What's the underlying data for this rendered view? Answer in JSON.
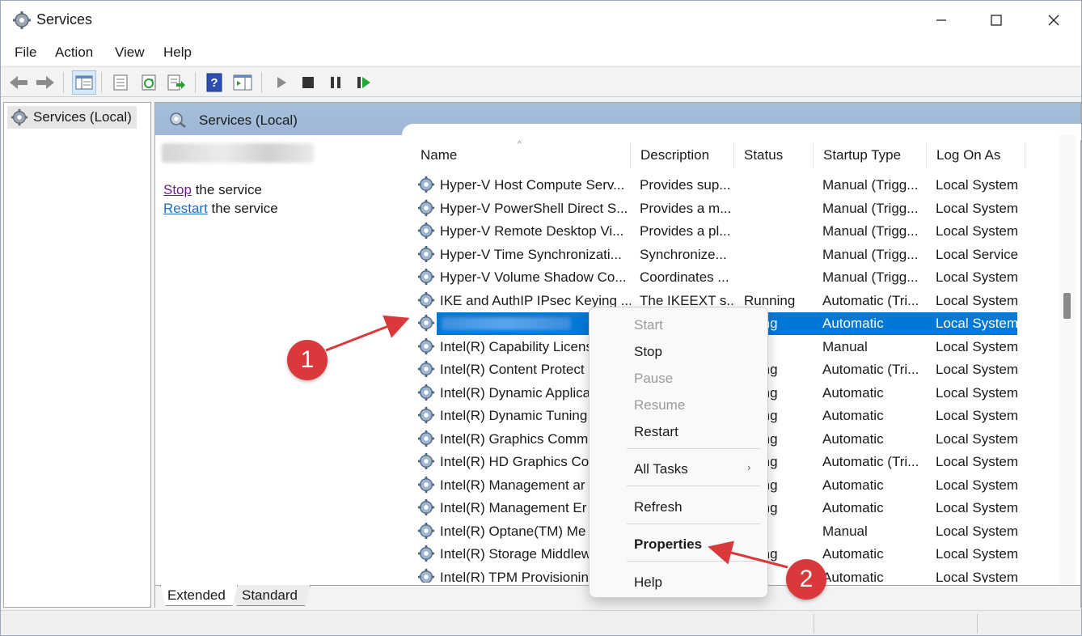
{
  "window": {
    "title": "Services",
    "controls": {
      "minimize": "minimize-icon",
      "maximize": "maximize-icon",
      "close": "close-icon"
    }
  },
  "menu": [
    "File",
    "Action",
    "View",
    "Help"
  ],
  "toolbar_icons": [
    "back-arrow-icon",
    "forward-arrow-icon",
    "show-hide-tree-icon",
    "properties-icon",
    "refresh-icon",
    "export-list-icon",
    "help-icon",
    "action-pane-icon",
    "start-service-icon",
    "stop-service-icon",
    "pause-service-icon",
    "restart-service-icon"
  ],
  "tree": {
    "item": "Services (Local)"
  },
  "panel": {
    "header": "Services (Local)",
    "actions": {
      "stop_link": "Stop",
      "stop_suffix": " the service",
      "restart_link": "Restart",
      "restart_suffix": " the service"
    }
  },
  "table": {
    "columns": {
      "name": "Name",
      "description": "Description",
      "status": "Status",
      "startup": "Startup Type",
      "logon": "Log On As"
    },
    "rows": [
      {
        "name": "Hyper-V Host Compute Serv...",
        "desc": "Provides sup...",
        "status": "",
        "startup": "Manual (Trigg...",
        "logon": "Local System"
      },
      {
        "name": "Hyper-V PowerShell Direct S...",
        "desc": "Provides a m...",
        "status": "",
        "startup": "Manual (Trigg...",
        "logon": "Local System"
      },
      {
        "name": "Hyper-V Remote Desktop Vi...",
        "desc": "Provides a pl...",
        "status": "",
        "startup": "Manual (Trigg...",
        "logon": "Local System"
      },
      {
        "name": "Hyper-V Time Synchronizati...",
        "desc": "Synchronize...",
        "status": "",
        "startup": "Manual (Trigg...",
        "logon": "Local Service"
      },
      {
        "name": "Hyper-V Volume Shadow Co...",
        "desc": "Coordinates ...",
        "status": "",
        "startup": "Manual (Trigg...",
        "logon": "Local System"
      },
      {
        "name": "IKE and AuthIP IPsec Keying ...",
        "desc": "The IKEEXT s...",
        "status": "Running",
        "startup": "Automatic (Tri...",
        "logon": "Local System"
      },
      {
        "name": "",
        "desc": "",
        "status": "nning",
        "startup": "Automatic",
        "logon": "Local System"
      },
      {
        "name": "Intel(R) Capability Licens",
        "desc": "",
        "status": "",
        "startup": "Manual",
        "logon": "Local System"
      },
      {
        "name": "Intel(R) Content Protect",
        "desc": "",
        "status": "nning",
        "startup": "Automatic (Tri...",
        "logon": "Local System"
      },
      {
        "name": "Intel(R) Dynamic Applica",
        "desc": "",
        "status": "nning",
        "startup": "Automatic",
        "logon": "Local System"
      },
      {
        "name": "Intel(R) Dynamic Tuning",
        "desc": "",
        "status": "nning",
        "startup": "Automatic",
        "logon": "Local System"
      },
      {
        "name": "Intel(R) Graphics Comm",
        "desc": "",
        "status": "nning",
        "startup": "Automatic",
        "logon": "Local System"
      },
      {
        "name": "Intel(R) HD Graphics Co",
        "desc": "",
        "status": "nning",
        "startup": "Automatic (Tri...",
        "logon": "Local System"
      },
      {
        "name": "Intel(R) Management ar",
        "desc": "",
        "status": "nning",
        "startup": "Automatic",
        "logon": "Local System"
      },
      {
        "name": "Intel(R) Management Er",
        "desc": "",
        "status": "nning",
        "startup": "Automatic",
        "logon": "Local System"
      },
      {
        "name": "Intel(R) Optane(TM) Me",
        "desc": "",
        "status": "",
        "startup": "Manual",
        "logon": "Local System"
      },
      {
        "name": "Intel(R) Storage Middlew",
        "desc": "",
        "status": "nning",
        "startup": "Automatic",
        "logon": "Local System"
      },
      {
        "name": "Intel(R) TPM Provisionin",
        "desc": "",
        "status": "",
        "startup": "Automatic",
        "logon": "Local System"
      }
    ]
  },
  "tabs": [
    "Extended",
    "Standard"
  ],
  "context_menu": {
    "start": "Start",
    "stop": "Stop",
    "pause": "Pause",
    "resume": "Resume",
    "restart": "Restart",
    "all_tasks": "All Tasks",
    "refresh": "Refresh",
    "properties": "Properties",
    "help": "Help"
  },
  "annotations": {
    "badge1": "1",
    "badge2": "2"
  },
  "colors": {
    "selection": "#0078d7",
    "header": "#a8bfda",
    "badge": "#d9393b",
    "link_visited": "#6b1f8a",
    "link": "#1a6fc7"
  }
}
